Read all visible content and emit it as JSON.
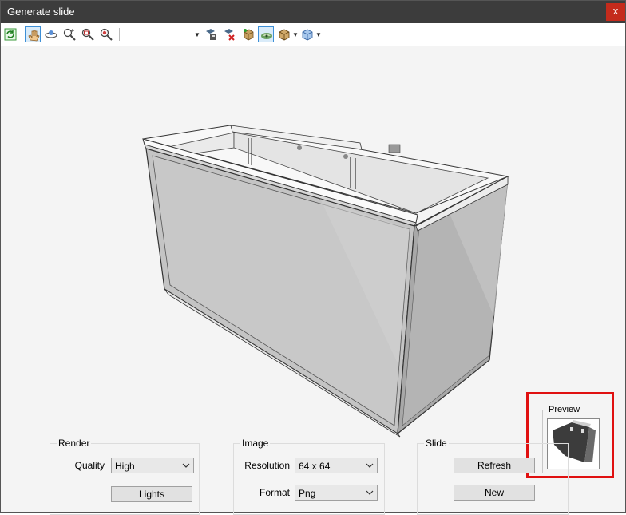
{
  "window": {
    "title": "Generate slide",
    "close_label": "x"
  },
  "toolbar": {
    "icons": [
      "refresh-icon",
      "hand-pan-icon",
      "orbit-icon",
      "zoom-in-icon",
      "zoom-window-icon",
      "zoom-extents-icon",
      "camera-save-icon",
      "camera-delete-icon",
      "textures-icon",
      "shading-icon",
      "box-views-icon",
      "cube-section-icon"
    ]
  },
  "preview": {
    "label": "Preview"
  },
  "render": {
    "label": "Render",
    "quality_label": "Quality",
    "quality_value": "High",
    "lights_label": "Lights"
  },
  "image": {
    "label": "Image",
    "resolution_label": "Resolution",
    "resolution_value": "64 x 64",
    "format_label": "Format",
    "format_value": "Png"
  },
  "slide": {
    "label": "Slide",
    "refresh_label": "Refresh",
    "new_label": "New"
  },
  "colors": {
    "titlebar": "#3c3c3c",
    "close": "#c42b1c",
    "highlight": "#e01010",
    "active_tool": "#3d8fd6"
  }
}
